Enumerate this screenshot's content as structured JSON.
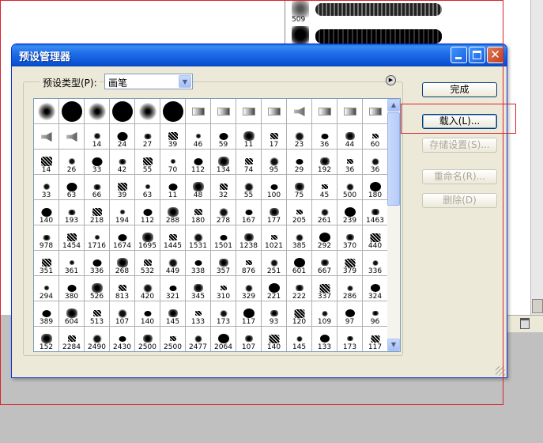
{
  "background_panel": {
    "brush_rows": [
      {
        "num": "509"
      },
      {
        "num": ""
      }
    ]
  },
  "dialog": {
    "title": "预设管理器",
    "preset_type_label": "预设类型(P):",
    "preset_type_value": "画笔",
    "buttons": {
      "done": "完成",
      "load": "载入(L)...",
      "save": "存储设置(S)...",
      "rename": "重命名(R)...",
      "delete": "删除(D)"
    },
    "grid_rows": [
      [
        "",
        "",
        "",
        "",
        "",
        "",
        "",
        "",
        "",
        "",
        "",
        "",
        "",
        ""
      ],
      [
        "",
        "",
        "14",
        "24",
        "27",
        "39",
        "46",
        "59",
        "11",
        "17",
        "23",
        "36",
        "44",
        "60"
      ],
      [
        "14",
        "26",
        "33",
        "42",
        "55",
        "70",
        "112",
        "134",
        "74",
        "95",
        "29",
        "192",
        "36",
        "36"
      ],
      [
        "33",
        "63",
        "66",
        "39",
        "63",
        "11",
        "48",
        "32",
        "55",
        "100",
        "75",
        "45",
        "500",
        "180"
      ],
      [
        "140",
        "193",
        "218",
        "194",
        "112",
        "288",
        "180",
        "278",
        "167",
        "177",
        "205",
        "261",
        "239",
        "1463"
      ],
      [
        "978",
        "1454",
        "1716",
        "1674",
        "1695",
        "1445",
        "1531",
        "1501",
        "1238",
        "1021",
        "385",
        "292",
        "370",
        "440"
      ],
      [
        "351",
        "361",
        "336",
        "268",
        "532",
        "449",
        "338",
        "357",
        "876",
        "251",
        "601",
        "667",
        "379",
        "336"
      ],
      [
        "294",
        "380",
        "526",
        "813",
        "420",
        "321",
        "345",
        "310",
        "329",
        "221",
        "222",
        "337",
        "286",
        "324"
      ],
      [
        "389",
        "604",
        "513",
        "107",
        "140",
        "145",
        "133",
        "173",
        "117",
        "93",
        "120",
        "109",
        "97",
        "96"
      ],
      [
        "152",
        "2284",
        "2490",
        "2430",
        "2500",
        "2500",
        "2477",
        "2064",
        "107",
        "140",
        "145",
        "133",
        "173",
        "117"
      ]
    ]
  }
}
